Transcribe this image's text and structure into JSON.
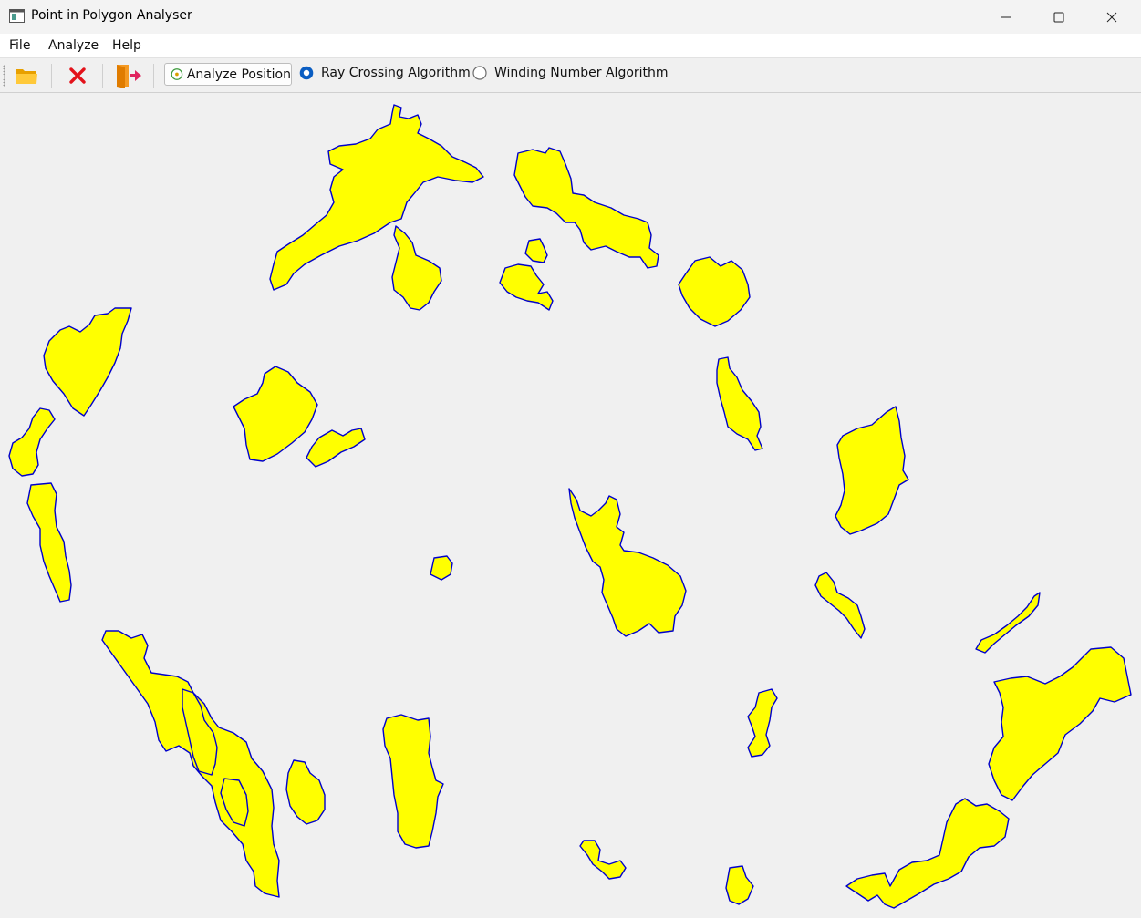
{
  "window": {
    "title": "Point in Polygon Analyser",
    "icon": "app-window-icon",
    "controls": [
      "minimize-icon",
      "maximize-icon",
      "close-icon"
    ]
  },
  "menu": {
    "items": [
      "File",
      "Analyze",
      "Help"
    ]
  },
  "toolbar": {
    "open_icon": "folder-open-icon",
    "clear_icon": "red-x-clear-icon",
    "exit_icon": "exit-door-icon",
    "analyze_label": "Analyze Position",
    "algorithms": [
      {
        "label": "Ray Crossing Algorithm",
        "selected": true
      },
      {
        "label": "Winding Number Algorithm",
        "selected": false
      }
    ]
  },
  "canvas": {
    "background": "#f0f0f0",
    "polygon_fill": "#ffff00",
    "polygon_stroke": "#0000cc"
  }
}
